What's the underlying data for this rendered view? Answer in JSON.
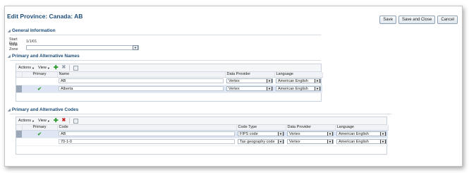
{
  "page": {
    "title": "Edit Province: Canada: AB",
    "buttons": {
      "save": "Save",
      "save_close": "Save and Close",
      "cancel": "Cancel"
    }
  },
  "general": {
    "heading": "General Information",
    "start_date_label": "Start Date",
    "start_date_value": "1/1/01",
    "time_zone_label": "Time Zone",
    "time_zone_value": ""
  },
  "names": {
    "heading": "Primary and Alternative Names",
    "toolbar": {
      "actions": "Actions",
      "view": "View"
    },
    "columns": {
      "primary": "Primary",
      "name": "Name",
      "provider": "Data Provider",
      "language": "Language"
    },
    "rows": [
      {
        "primary": "",
        "name": "AB",
        "provider": "Vertex",
        "language": "American English"
      },
      {
        "primary": "✔",
        "name": "Alberta",
        "provider": "Vertex",
        "language": "American English"
      }
    ]
  },
  "codes": {
    "heading": "Primary and Alternative Codes",
    "toolbar": {
      "actions": "Actions",
      "view": "View"
    },
    "columns": {
      "primary": "Primary",
      "code": "Code",
      "code_type": "Code Type",
      "provider": "Data Provider",
      "language": "Language"
    },
    "rows": [
      {
        "primary": "✔",
        "code": "AB",
        "code_type": "FIPS code",
        "provider": "Vertex",
        "language": "American English"
      },
      {
        "primary": "",
        "code": "70-1-0",
        "code_type": "Tax geography code",
        "provider": "Vertex",
        "language": "American English"
      }
    ]
  },
  "icons": {
    "collapse": "disclosure-triangle-icon",
    "add": "plus-icon",
    "delete": "x-icon",
    "detach": "detach-icon",
    "dropdown": "chevron-down-icon",
    "check": "checkmark-icon"
  },
  "colors": {
    "title": "#1f4e79",
    "add": "#2e9a2e",
    "delete": "#c62222",
    "selected_row": "#dde6f2"
  }
}
